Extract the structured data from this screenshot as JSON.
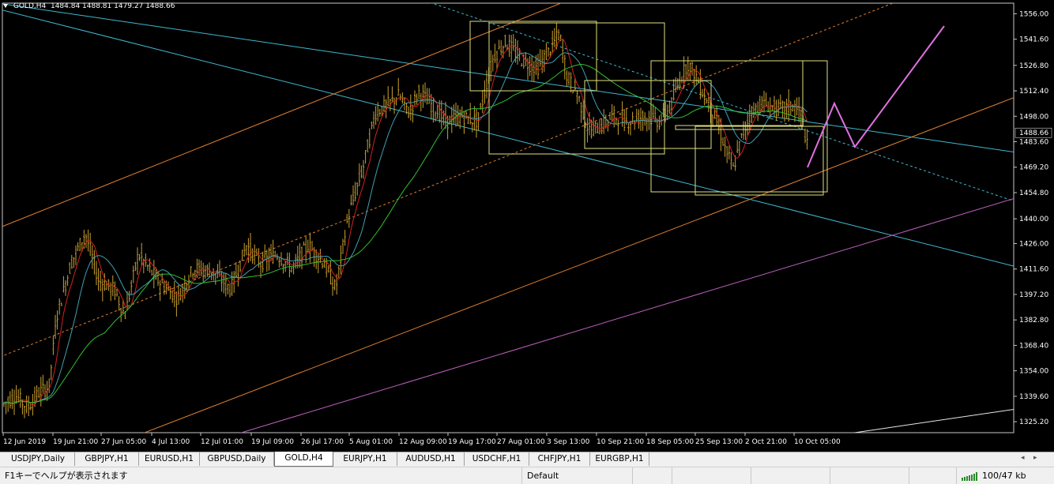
{
  "header": {
    "symbol": "GOLD,H4",
    "ohlc": "1484.84 1488.81 1479.27 1488.66"
  },
  "price_axis": {
    "labels": [
      "1556.00",
      "1541.60",
      "1526.80",
      "1512.40",
      "1498.00",
      "1483.60",
      "1469.20",
      "1454.80",
      "1440.00",
      "1426.00",
      "1411.60",
      "1397.20",
      "1382.80",
      "1368.40",
      "1354.00",
      "1339.60",
      "1325.20"
    ],
    "current_price": "1488.66",
    "current_price_color": "#ffffff"
  },
  "time_axis": {
    "labels": [
      "12 Jun 2019",
      "19 Jun 21:00",
      "27 Jun 05:00",
      "4 Jul 13:00",
      "12 Jul 01:00",
      "19 Jul 09:00",
      "26 Jul 17:00",
      "5 Aug 01:00",
      "12 Aug 09:00",
      "19 Aug 17:00",
      "27 Aug 01:00",
      "3 Sep 13:00",
      "10 Sep 21:00",
      "18 Sep 05:00",
      "25 Sep 13:00",
      "2 Oct 21:00",
      "10 Oct 05:00"
    ]
  },
  "colors": {
    "background": "#000000",
    "candles": "#c8a030",
    "ma_fast": "#d42020",
    "ma_mid": "#40a0b0",
    "ma_slow": "#30c030",
    "channel_cyan": "#40b8d0",
    "channel_orange": "#e08030",
    "line_magenta": "#c060c0",
    "boxes": "#e0e080",
    "projection": "#e070e0"
  },
  "tabs": [
    {
      "label": "USDJPY,Daily",
      "active": false
    },
    {
      "label": "GBPJPY,H1",
      "active": false
    },
    {
      "label": "EURUSD,H1",
      "active": false
    },
    {
      "label": "GBPUSD,Daily",
      "active": false
    },
    {
      "label": "GOLD,H4",
      "active": true
    },
    {
      "label": "EURJPY,H1",
      "active": false
    },
    {
      "label": "AUDUSD,H1",
      "active": false
    },
    {
      "label": "USDCHF,H1",
      "active": false
    },
    {
      "label": "CHFJPY,H1",
      "active": false
    },
    {
      "label": "EURGBP,H1",
      "active": false
    }
  ],
  "status": {
    "help": "F1キーでヘルプが表示されます",
    "profile": "Default",
    "traffic": "100/47 kb"
  },
  "icons": {
    "tab_left": "scroll-left-icon",
    "tab_right": "scroll-right-icon",
    "connection": "connection-bars-icon"
  }
}
